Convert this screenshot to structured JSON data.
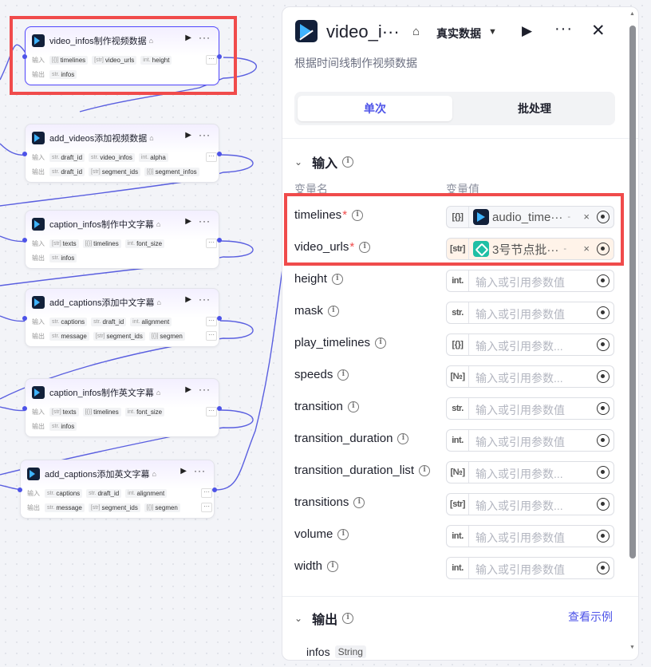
{
  "canvas": {
    "nodes": [
      {
        "title": "video_infos制作视频数据",
        "in_label": "输入",
        "out_label": "输出",
        "inputs": [
          {
            "t": "[{}]",
            "n": "timelines"
          },
          {
            "t": "[str]",
            "n": "video_urls"
          },
          {
            "t": "int.",
            "n": "height"
          }
        ],
        "outputs": [
          {
            "t": "str.",
            "n": "infos"
          }
        ],
        "in_more": "···",
        "out_more": ""
      },
      {
        "title": "add_videos添加视频数据",
        "in_label": "输入",
        "out_label": "输出",
        "inputs": [
          {
            "t": "str.",
            "n": "draft_id"
          },
          {
            "t": "str.",
            "n": "video_infos"
          },
          {
            "t": "int.",
            "n": "alpha"
          }
        ],
        "outputs": [
          {
            "t": "str.",
            "n": "draft_id"
          },
          {
            "t": "[str]",
            "n": "segment_ids"
          },
          {
            "t": "[{}]",
            "n": "segment_infos"
          }
        ],
        "in_more": "···",
        "out_more": ""
      },
      {
        "title": "caption_infos制作中文字幕",
        "in_label": "输入",
        "out_label": "输出",
        "inputs": [
          {
            "t": "[str]",
            "n": "texts"
          },
          {
            "t": "[{}]",
            "n": "timelines"
          },
          {
            "t": "int.",
            "n": "font_size"
          }
        ],
        "outputs": [
          {
            "t": "str.",
            "n": "infos"
          }
        ],
        "in_more": "···",
        "out_more": ""
      },
      {
        "title": "add_captions添加中文字幕",
        "in_label": "输入",
        "out_label": "输出",
        "inputs": [
          {
            "t": "str.",
            "n": "captions"
          },
          {
            "t": "str.",
            "n": "draft_id"
          },
          {
            "t": "int.",
            "n": "alignment"
          }
        ],
        "outputs": [
          {
            "t": "str.",
            "n": "message"
          },
          {
            "t": "[str]",
            "n": "segment_ids"
          },
          {
            "t": "[{}]",
            "n": "segmen"
          }
        ],
        "in_more": "···",
        "out_more": "···"
      },
      {
        "title": "caption_infos制作英文字幕",
        "in_label": "输入",
        "out_label": "输出",
        "inputs": [
          {
            "t": "[str]",
            "n": "texts"
          },
          {
            "t": "[{}]",
            "n": "timelines"
          },
          {
            "t": "int.",
            "n": "font_size"
          }
        ],
        "outputs": [
          {
            "t": "str.",
            "n": "infos"
          }
        ],
        "in_more": "···",
        "out_more": ""
      },
      {
        "title": "add_captions添加英文字幕",
        "in_label": "输入",
        "out_label": "输出",
        "inputs": [
          {
            "t": "str.",
            "n": "captions"
          },
          {
            "t": "str.",
            "n": "draft_id"
          },
          {
            "t": "int.",
            "n": "alignment"
          }
        ],
        "outputs": [
          {
            "t": "str.",
            "n": "message"
          },
          {
            "t": "[str]",
            "n": "segment_ids"
          },
          {
            "t": "[{}]",
            "n": "segmen"
          }
        ],
        "in_more": "···",
        "out_more": "···"
      }
    ]
  },
  "panel": {
    "title": "video_i···",
    "mode": "真实数据",
    "description": "根据时间线制作视频数据",
    "tabs": [
      "单次",
      "批处理"
    ],
    "input_section": "输入",
    "col_name": "变量名",
    "col_value": "变量值",
    "params": [
      {
        "name": "timelines",
        "required": "*",
        "type": "[{}]",
        "ref": "audio_time···",
        "ref_icon": "dark",
        "ref_suffix": "-",
        "x": "×"
      },
      {
        "name": "video_urls",
        "required": "*",
        "type": "[str]",
        "ref": "3号节点批···",
        "ref_icon": "teal",
        "ref_suffix": "-",
        "x": "×"
      },
      {
        "name": "height",
        "type": "int.",
        "placeholder": "输入或引用参数值"
      },
      {
        "name": "mask",
        "type": "str.",
        "placeholder": "输入或引用参数值"
      },
      {
        "name": "play_timelines",
        "type": "[{}]",
        "placeholder": "输入或引用参数..."
      },
      {
        "name": "speeds",
        "type": "[№]",
        "placeholder": "输入或引用参数..."
      },
      {
        "name": "transition",
        "type": "str.",
        "placeholder": "输入或引用参数值"
      },
      {
        "name": "transition_duration",
        "type": "int.",
        "placeholder": "输入或引用参数值"
      },
      {
        "name": "transition_duration_list",
        "type": "[№]",
        "placeholder": "输入或引用参数..."
      },
      {
        "name": "transitions",
        "type": "[str]",
        "placeholder": "输入或引用参数..."
      },
      {
        "name": "volume",
        "type": "int.",
        "placeholder": "输入或引用参数值"
      },
      {
        "name": "width",
        "type": "int.",
        "placeholder": "输入或引用参数值"
      }
    ],
    "output_section": "输出",
    "view_example": "查看示例",
    "output_name": "infos",
    "output_type": "String"
  },
  "colors": {
    "accent": "#4d53e8",
    "highlight": "#f04b4b",
    "wire": "#4d53e8"
  }
}
